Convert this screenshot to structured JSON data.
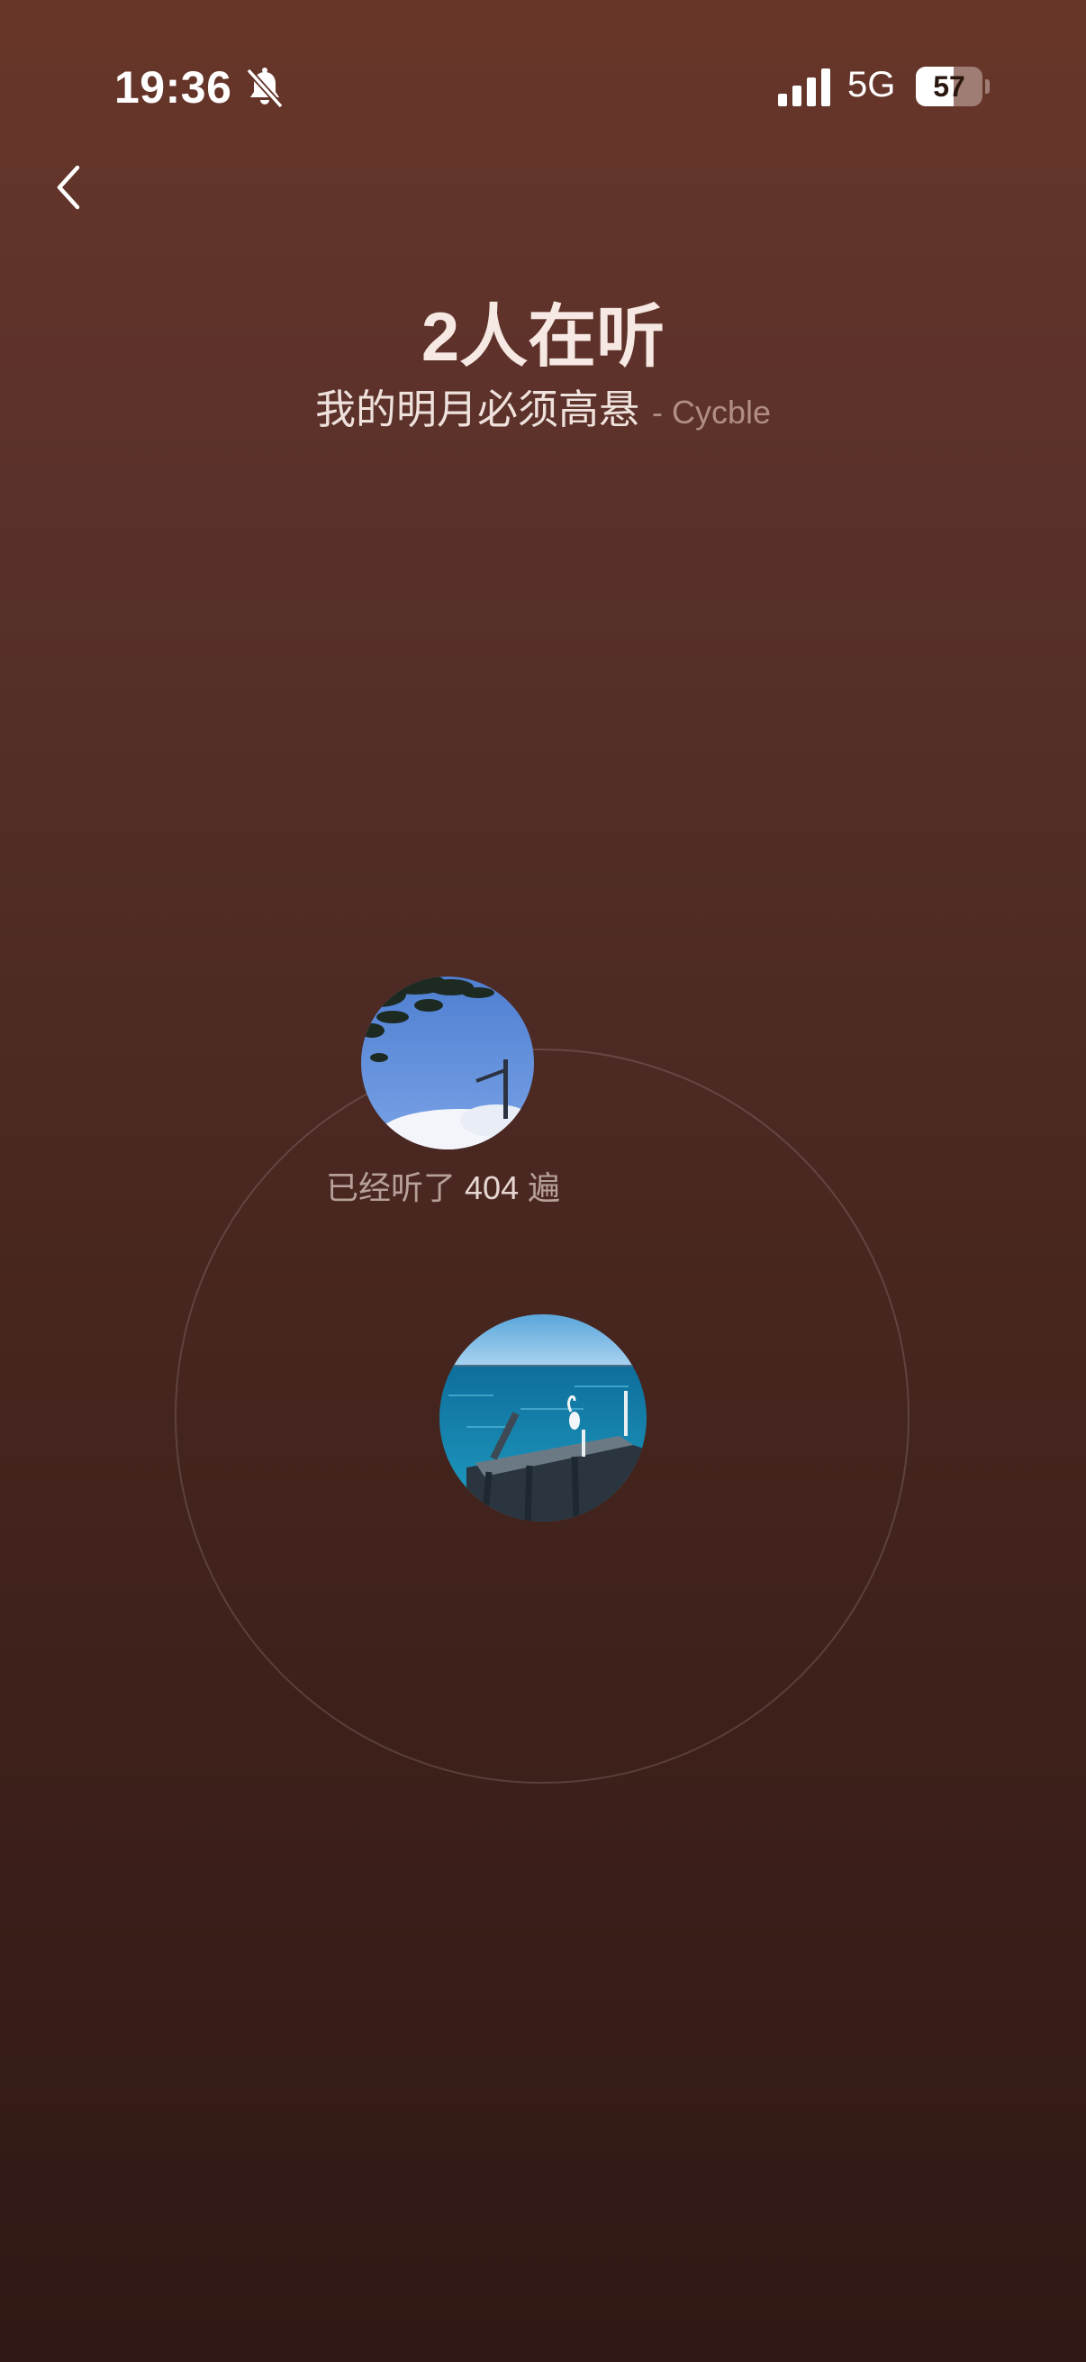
{
  "status_bar": {
    "time": "19:36",
    "network": "5G",
    "battery": "57",
    "battery_level_percent": 57,
    "icons": [
      "bell-off-icon",
      "signal-icon",
      "battery-icon"
    ]
  },
  "header": {
    "back_icon": "chevron-left-icon",
    "title": "2人在听",
    "song": "我的明月必须高悬",
    "artist": "- Cycble"
  },
  "listeners": [
    {
      "avatar": "sky-tree-photo",
      "listen_prefix": "已经听了",
      "listen_count": "404",
      "listen_suffix": "遍"
    },
    {
      "avatar": "sea-pier-egret-photo"
    }
  ],
  "colors": {
    "background_top": "#683629",
    "background_bottom": "#301814",
    "title_text": "#f6e8e3",
    "secondary_text": "#b08e85"
  }
}
